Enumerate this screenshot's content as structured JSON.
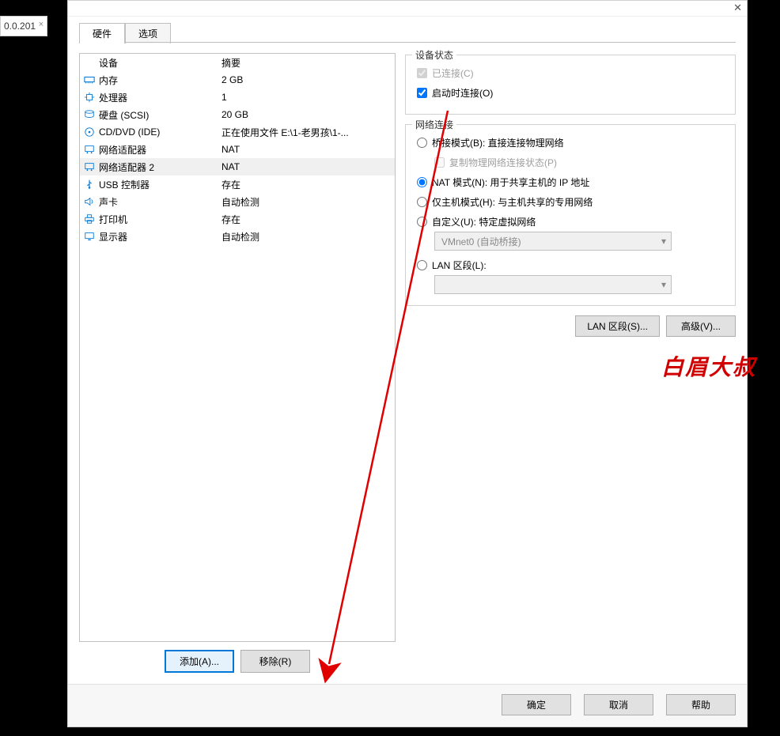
{
  "left_tab_fragment": "0.0.201",
  "dialog_title_partial": "...",
  "tabs": {
    "hardware": "硬件",
    "options": "选项"
  },
  "list_headers": {
    "device": "设备",
    "summary": "摘要"
  },
  "devices": [
    {
      "name": "内存",
      "summary": "2 GB",
      "icon": "memory"
    },
    {
      "name": "处理器",
      "summary": "1",
      "icon": "cpu"
    },
    {
      "name": "硬盘 (SCSI)",
      "summary": "20 GB",
      "icon": "disk"
    },
    {
      "name": "CD/DVD (IDE)",
      "summary": "正在使用文件 E:\\1-老男孩\\1-...",
      "icon": "disc"
    },
    {
      "name": "网络适配器",
      "summary": "NAT",
      "icon": "network"
    },
    {
      "name": "网络适配器 2",
      "summary": "NAT",
      "icon": "network",
      "selected": true
    },
    {
      "name": "USB 控制器",
      "summary": "存在",
      "icon": "usb"
    },
    {
      "name": "声卡",
      "summary": "自动检测",
      "icon": "sound"
    },
    {
      "name": "打印机",
      "summary": "存在",
      "icon": "printer"
    },
    {
      "name": "显示器",
      "summary": "自动检测",
      "icon": "display"
    }
  ],
  "add_btn": "添加(A)...",
  "remove_btn": "移除(R)",
  "device_status": {
    "legend": "设备状态",
    "connected": "已连接(C)",
    "connect_at_poweron": "启动时连接(O)"
  },
  "network_connection": {
    "legend": "网络连接",
    "bridged": "桥接模式(B): 直接连接物理网络",
    "replicate": "复制物理网络连接状态(P)",
    "nat": "NAT 模式(N): 用于共享主机的 IP 地址",
    "hostonly": "仅主机模式(H): 与主机共享的专用网络",
    "custom": "自定义(U): 特定虚拟网络",
    "custom_select": "VMnet0 (自动桥接)",
    "lansegment": "LAN 区段(L):",
    "lansegment_select": ""
  },
  "lan_btn": "LAN 区段(S)...",
  "advanced_btn": "高级(V)...",
  "footer": {
    "ok": "确定",
    "cancel": "取消",
    "help": "帮助"
  },
  "watermark": "白眉大叔"
}
